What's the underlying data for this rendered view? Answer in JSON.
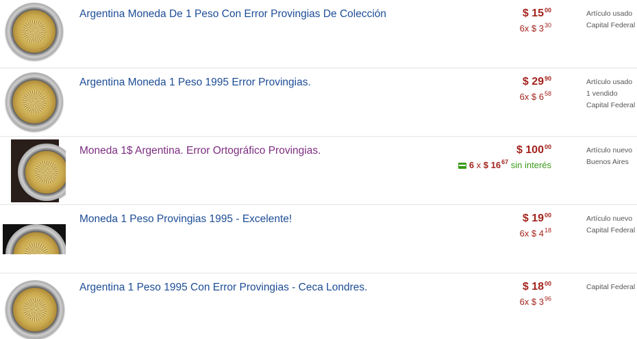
{
  "listings": [
    {
      "title": "Argentina Moneda De 1 Peso Con Error Provingias De Colección",
      "price_int": "$ 15",
      "price_dec": "00",
      "installments": "6x $ 3",
      "installments_dec": "30",
      "condition": "Artículo usado",
      "sold": "",
      "location": "Capital Federal",
      "visited": false
    },
    {
      "title": "Argentina Moneda 1 Peso 1995 Error Provingias.",
      "price_int": "$ 29",
      "price_dec": "90",
      "installments": "6x $ 6",
      "installments_dec": "58",
      "condition": "Artículo usado",
      "sold": "1 vendido",
      "location": "Capital Federal",
      "visited": false
    },
    {
      "title": "Moneda 1$ Argentina. Error Ortográfico Provingias.",
      "price_int": "$ 100",
      "price_dec": "00",
      "installments_pre": "6",
      "installments_x": "x",
      "installments_amount": "$ 16",
      "installments_dec": "67",
      "installments_note": "sin interés",
      "condition": "Artículo nuevo",
      "sold": "",
      "location": "Buenos Aires",
      "visited": true,
      "icon": "credit-card-icon",
      "accent": "#3a9a1a"
    },
    {
      "title": "Moneda 1 Peso Provingias 1995 - Excelente!",
      "price_int": "$ 19",
      "price_dec": "00",
      "installments": "6x $ 4",
      "installments_dec": "18",
      "condition": "Artículo nuevo",
      "sold": "",
      "location": "Capital Federal",
      "visited": false
    },
    {
      "title": "Argentina 1 Peso 1995 Con Error Provingias - Ceca Londres.",
      "price_int": "$ 18",
      "price_dec": "00",
      "installments": "6x $ 3",
      "installments_dec": "96",
      "condition": "",
      "sold": "",
      "location": "Capital Federal",
      "visited": false
    }
  ],
  "colors": {
    "link": "#1c4c95",
    "visited": "#7c2d80",
    "price": "#a3231d"
  }
}
